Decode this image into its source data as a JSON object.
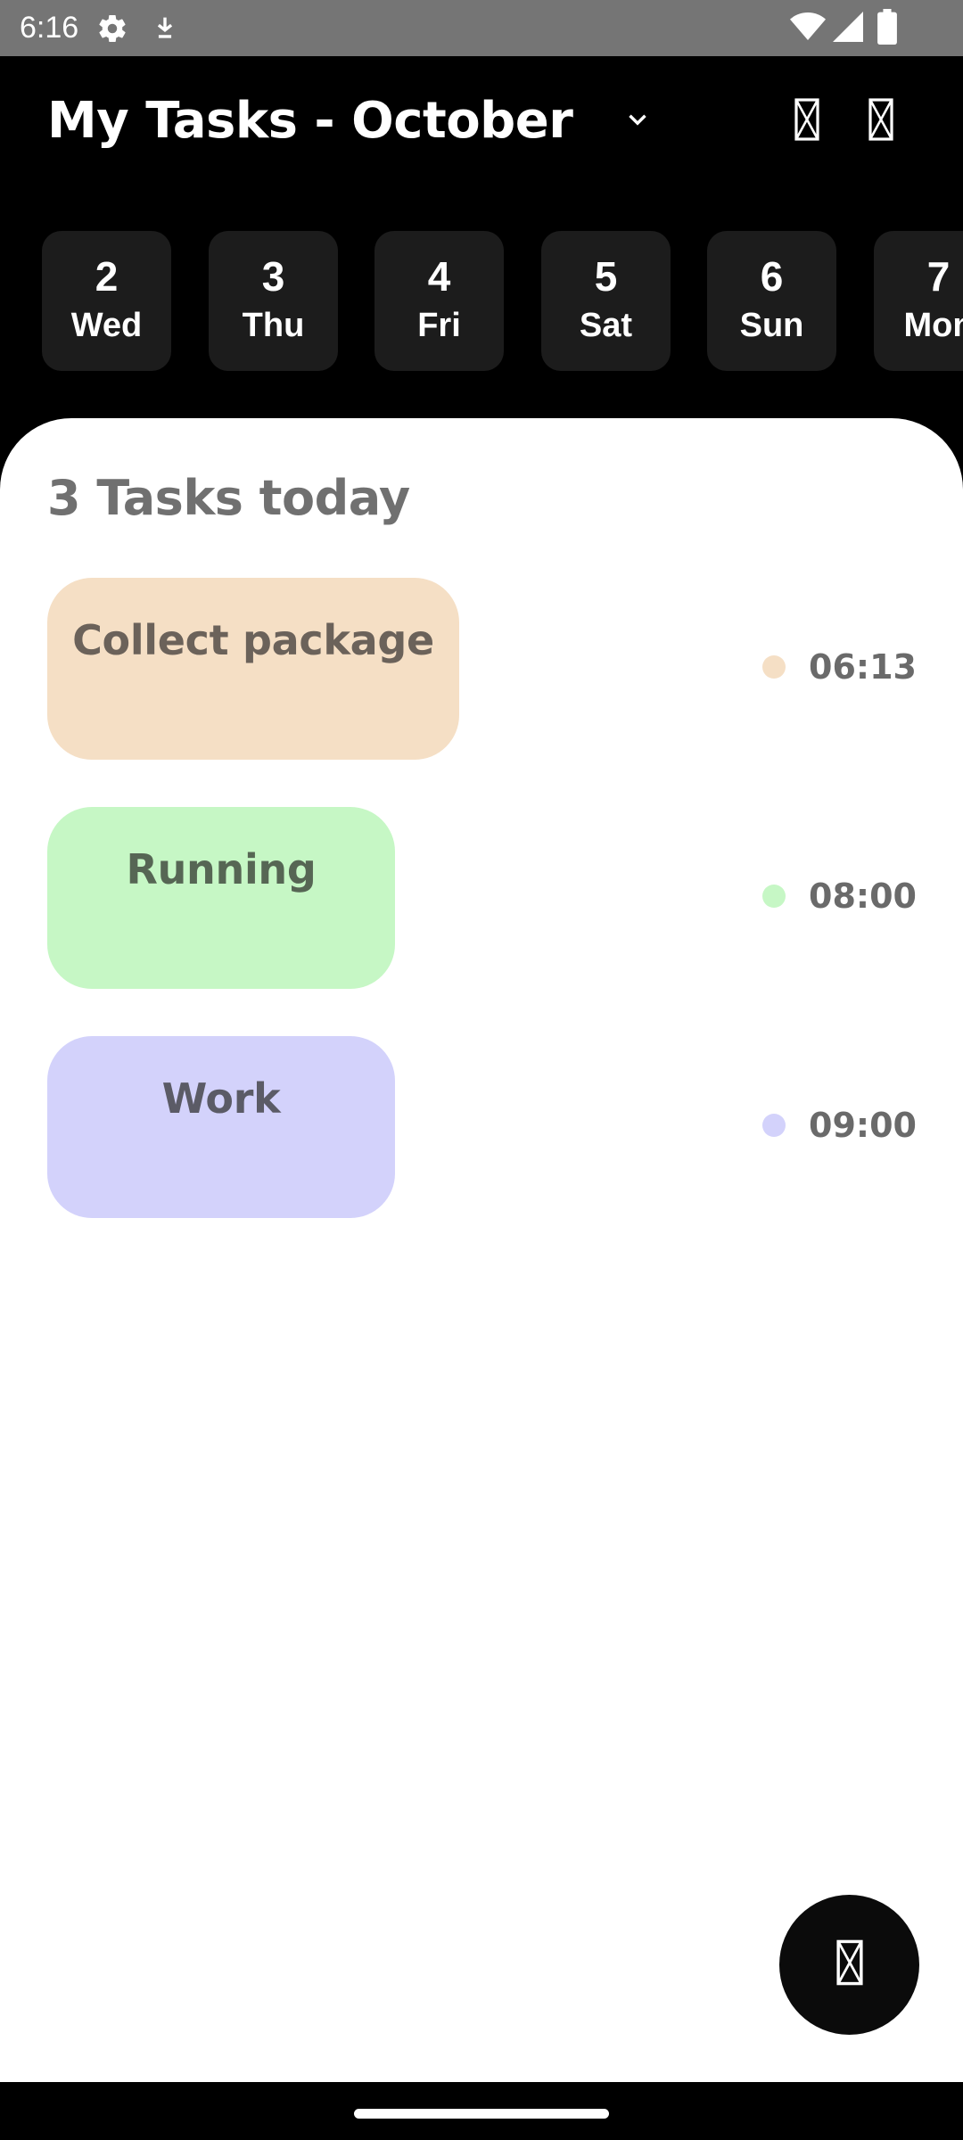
{
  "status_bar": {
    "time": "6:16",
    "icons": [
      "gear-icon",
      "download-icon",
      "wifi-icon",
      "signal-icon",
      "battery-icon"
    ],
    "background": "#757575"
  },
  "header": {
    "title": "My Tasks - October",
    "dropdown_icon": "chevron-down-icon",
    "action_icons": [
      "missing-glyph-icon",
      "missing-glyph-icon"
    ]
  },
  "date_strip": {
    "selected_color": "#e2572d",
    "days": [
      {
        "num": "2",
        "day": "Wed",
        "selected": true
      },
      {
        "num": "3",
        "day": "Thu",
        "selected": false
      },
      {
        "num": "4",
        "day": "Fri",
        "selected": false
      },
      {
        "num": "5",
        "day": "Sat",
        "selected": false
      },
      {
        "num": "6",
        "day": "Sun",
        "selected": false
      },
      {
        "num": "7",
        "day": "Mon",
        "selected": false
      }
    ]
  },
  "tasks": {
    "heading": "3 Tasks today",
    "items": [
      {
        "title": "Collect package",
        "time": "06:13",
        "color": "#f5dfc5",
        "text_color": "#6b625a"
      },
      {
        "title": "Running",
        "time": "08:00",
        "color": "#c6f7c5",
        "text_color": "#566654"
      },
      {
        "title": "Work",
        "time": "09:00",
        "color": "#d3d2fb",
        "text_color": "#5b5b66"
      }
    ]
  },
  "fab": {
    "icon": "missing-glyph-icon"
  }
}
